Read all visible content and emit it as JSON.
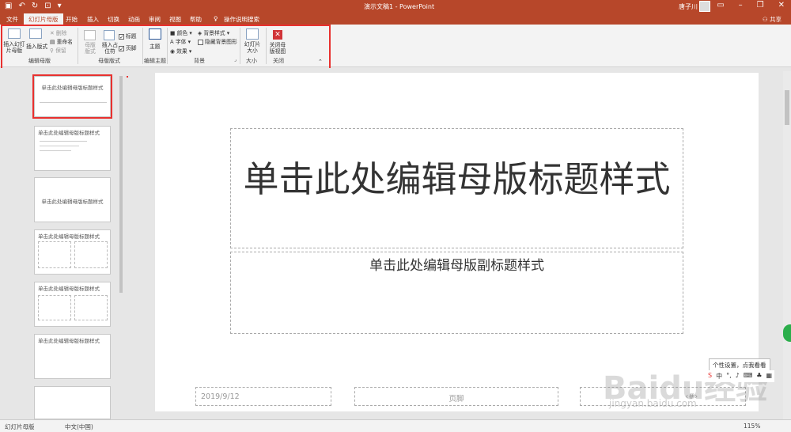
{
  "titlebar": {
    "doc_title": "演示文稿1  -  PowerPoint",
    "user": "唐子川",
    "qat_icons": [
      "save-icon",
      "undo-icon",
      "redo-icon",
      "present-icon",
      "customize-icon"
    ]
  },
  "tabs": [
    {
      "label": "文件"
    },
    {
      "label": "幻灯片母版"
    },
    {
      "label": "开始"
    },
    {
      "label": "插入"
    },
    {
      "label": "切换"
    },
    {
      "label": "动画"
    },
    {
      "label": "审阅"
    },
    {
      "label": "视图"
    },
    {
      "label": "帮助"
    },
    {
      "label": "操作说明搜索"
    }
  ],
  "share_label": "共享",
  "ribbon": {
    "insert_master": "插入幻灯片母版",
    "insert_layout": "插入版式",
    "delete": "删除",
    "rename": "重命名",
    "preserve": "保留",
    "edit_master_group": "编辑母版",
    "master_layout": "母版版式",
    "insert_placeholder": "插入占位符",
    "title_chk": "标题",
    "footer_chk": "页脚",
    "master_layout_group": "母版版式",
    "theme": "主题",
    "edit_theme_group": "编辑主题",
    "colors": "颜色",
    "fonts": "字体",
    "effects": "效果",
    "bg_styles": "背景样式",
    "hide_bg": "隐藏背景图形",
    "bg_group": "背景",
    "slide_size": "幻灯片大小",
    "size_group": "大小",
    "close_master": "关闭母版视图",
    "close_group": "关闭"
  },
  "thumbnails": [
    {
      "title": "单击此处编辑母版标题样式"
    },
    {
      "title": "单击此处编辑母版标题样式"
    },
    {
      "title": "单击此处编辑母版标题样式"
    },
    {
      "title": "单击此处编辑母版标题样式"
    },
    {
      "title": "单击此处编辑母版标题样式"
    },
    {
      "title": "单击此处编辑母版标题样式"
    }
  ],
  "slide": {
    "title": "单击此处编辑母版标题样式",
    "subtitle": "单击此处编辑母版副标题样式",
    "date": "2019/9/12",
    "footer": "页脚",
    "page_num": "‹#›"
  },
  "status": {
    "view": "幻灯片母版",
    "language": "中文(中国)",
    "zoom": "115%"
  },
  "tooltip": "个性设置，点我看看",
  "watermark": "Baidu经验",
  "watermark_url": "jingyan.baidu.com",
  "colors": {
    "accent": "#b7472a",
    "highlight": "#e8312f"
  }
}
